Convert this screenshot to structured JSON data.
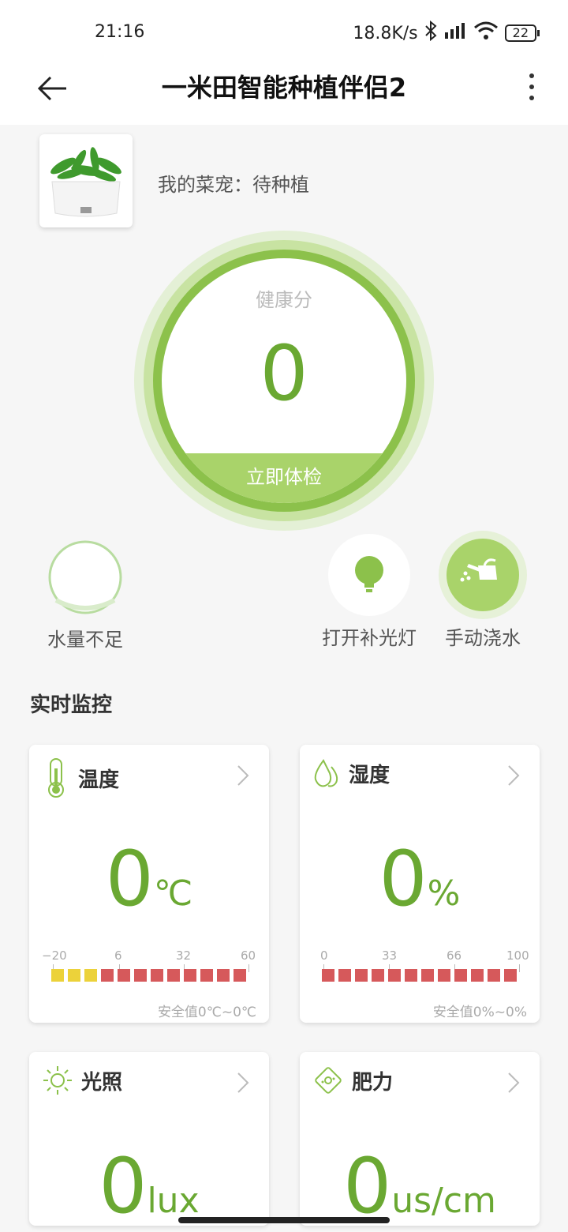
{
  "status": {
    "time": "21:16",
    "net_speed": "18.8K/s",
    "battery": "22"
  },
  "header": {
    "title": "一米田智能种植伴侣2"
  },
  "plant": {
    "label": "我的菜宠：待种植"
  },
  "health": {
    "title": "健康分",
    "score": "0",
    "check_button": "立即体检"
  },
  "actions": {
    "water_status": "水量不足",
    "light_button": "打开补光灯",
    "water_button": "手动浇水"
  },
  "monitor": {
    "section_title": "实时监控",
    "temperature": {
      "label": "温度",
      "value": "0",
      "unit": "℃",
      "ticks": [
        "−20",
        "6",
        "32",
        "60"
      ],
      "safe": "安全值0℃~0℃"
    },
    "humidity": {
      "label": "湿度",
      "value": "0",
      "unit": "%",
      "ticks": [
        "0",
        "33",
        "66",
        "100"
      ],
      "safe": "安全值0%~0%"
    },
    "light": {
      "label": "光照",
      "value": "0",
      "unit": "lux"
    },
    "fertility": {
      "label": "肥力",
      "value": "0",
      "unit": "us/cm"
    }
  },
  "colors": {
    "accent": "#6aa832",
    "light_green": "#a9d36a",
    "yellow": "#ecd23a",
    "red": "#d6595b"
  }
}
